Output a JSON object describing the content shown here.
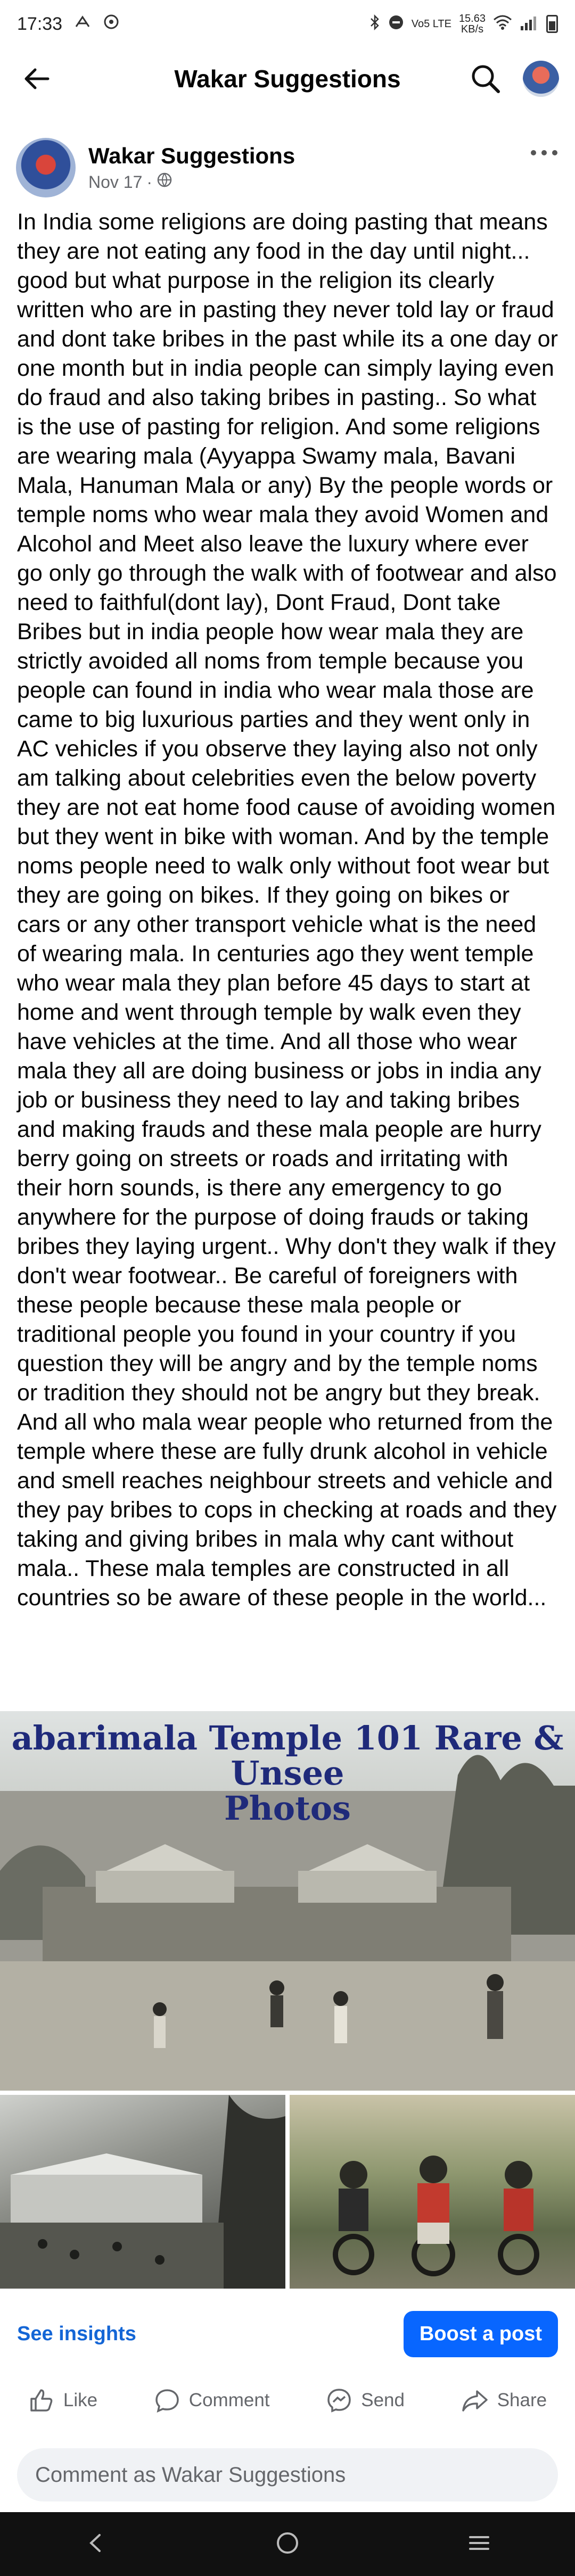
{
  "status_bar": {
    "time": "17:33",
    "speed_value": "15.63",
    "speed_unit": "KB/s",
    "network": "Vo5 LTE"
  },
  "app_bar": {
    "title": "Wakar Suggestions"
  },
  "post": {
    "author": "Wakar Suggestions",
    "date": "Nov 17",
    "separator": "·",
    "body": "In India some religions are doing pasting that means they are not eating any food in the day until night... good but what purpose in the religion its clearly written who are in pasting they never told lay or fraud and dont take bribes in the past while its a one day or one month but in india people can simply laying even do fraud and also taking bribes in pasting.. So what is the use of pasting for religion. And some religions are wearing mala (Ayyappa Swamy mala, Bavani Mala, Hanuman Mala or any) By the people words or temple noms who wear mala they avoid Women and Alcohol and Meet also leave the luxury where ever go only go through the walk with of footwear and also need to faithful(dont lay), Dont Fraud, Dont take Bribes but in india people how wear mala they are strictly avoided all noms from temple because you people can found in india who wear mala those are came to big luxurious parties and they went only in AC vehicles if you observe they laying also not only am talking about celebrities even the below poverty they are not eat home food cause of avoiding women but they went in bike with woman. And by the temple noms people need to walk only without foot wear but they are going on bikes. If they going on bikes or cars or any other transport vehicle what is the need of wearing mala. In centuries ago they went temple who wear mala they plan before 45 days to start at home and went through temple by walk even they have vehicles at the time. And all those who wear mala they all are doing business or jobs in india any job or business they need to lay and taking bribes and making frauds and these mala people are hurry berry going on streets or roads and irritating with their horn sounds, is there any emergency to go anywhere for the purpose of doing frauds or taking bribes they laying urgent.. Why don't they walk if they don't wear footwear.. Be careful of foreigners with these people because these mala people or traditional people you found in your country if you question they will be angry and by the temple noms or tradition they should not be angry but they break. And all who mala wear people who returned from the temple where these are fully drunk alcohol in vehicle and smell reaches neighbour streets and vehicle and they pay bribes to cops in checking at roads and they taking and giving bribes in mala why cant without mala.. These mala temples are constructed in all countries so be aware of these people in the world...",
    "image_title_line1": "abarimala Temple 101 Rare & Unsee",
    "image_title_line2": "Photos"
  },
  "actions": {
    "insights": "See insights",
    "boost": "Boost a post",
    "like": "Like",
    "comment": "Comment",
    "send": "Send",
    "share": "Share"
  },
  "comment_input": {
    "placeholder": "Comment as Wakar Suggestions"
  },
  "colors": {
    "accent": "#0866ff",
    "link": "#1466d6",
    "muted": "#65676b"
  }
}
